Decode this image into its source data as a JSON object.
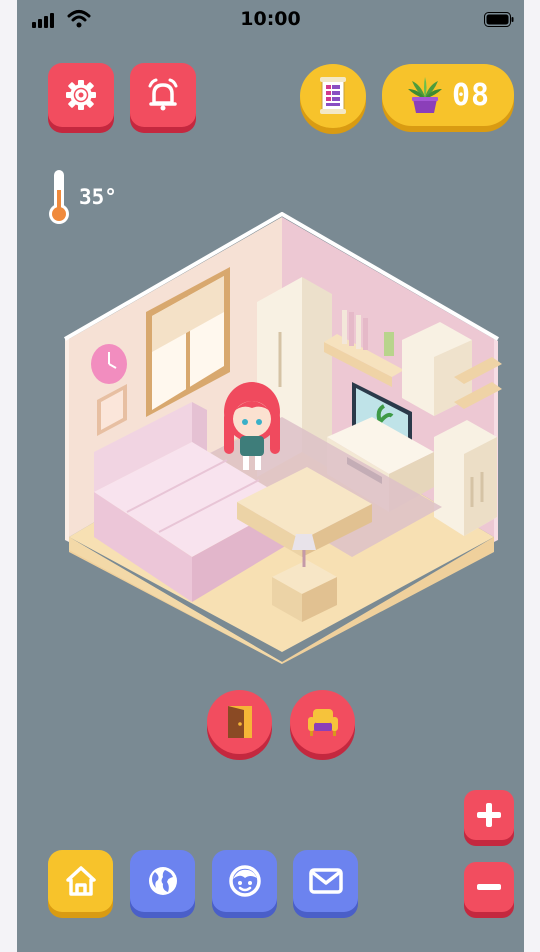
{
  "status_bar": {
    "time": "10:00"
  },
  "top_bar": {
    "settings_icon": "gear-icon",
    "alarm_icon": "alarm-bell-icon",
    "notes_icon": "scroll-list-icon",
    "plant_count": "08"
  },
  "temperature": {
    "value": "35°"
  },
  "room_actions": {
    "door_icon": "door-icon",
    "furniture_icon": "armchair-icon"
  },
  "zoom": {
    "in_icon": "plus-icon",
    "out_icon": "minus-icon"
  },
  "bottom_nav": {
    "items": [
      {
        "icon": "home-icon",
        "active": true
      },
      {
        "icon": "globe-icon",
        "active": false
      },
      {
        "icon": "face-icon",
        "active": false
      },
      {
        "icon": "mail-icon",
        "active": false
      }
    ]
  },
  "colors": {
    "background": "#7a8a93",
    "red": "#f24d5f",
    "yellow": "#f7c32b",
    "blue": "#6c83ef"
  }
}
